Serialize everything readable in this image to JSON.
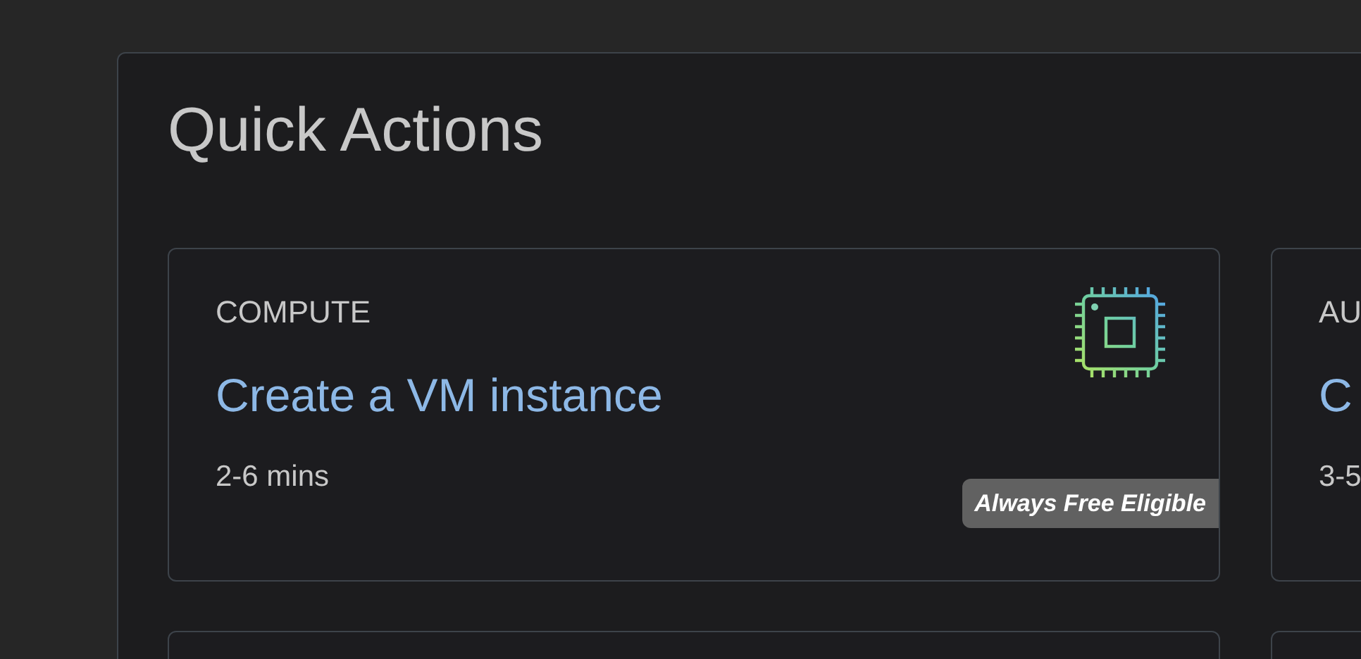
{
  "panel": {
    "title": "Quick Actions"
  },
  "cards": [
    {
      "category": "COMPUTE",
      "title": "Create a VM instance",
      "duration": "2-6 mins",
      "badge": "Always Free Eligible"
    },
    {
      "category": "AU",
      "title": "C",
      "duration": "3-5"
    }
  ]
}
